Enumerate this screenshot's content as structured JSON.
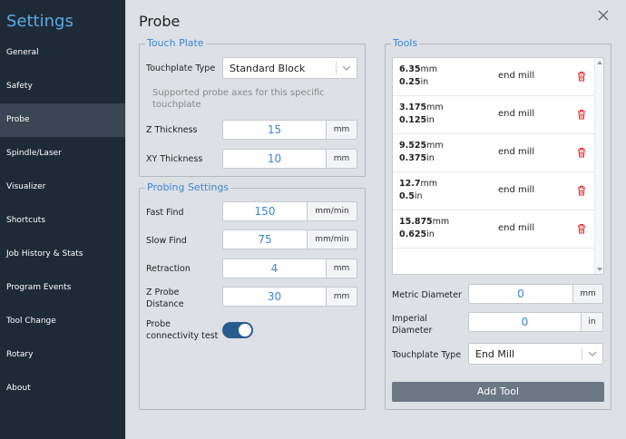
{
  "sidebar": {
    "title": "Settings",
    "items": [
      {
        "label": "General"
      },
      {
        "label": "Safety"
      },
      {
        "label": "Probe"
      },
      {
        "label": "Spindle/Laser"
      },
      {
        "label": "Visualizer"
      },
      {
        "label": "Shortcuts"
      },
      {
        "label": "Job History & Stats"
      },
      {
        "label": "Program Events"
      },
      {
        "label": "Tool Change"
      },
      {
        "label": "Rotary"
      },
      {
        "label": "About"
      }
    ],
    "active": "Probe"
  },
  "page": {
    "title": "Probe"
  },
  "touch_plate": {
    "legend": "Touch Plate",
    "type_label": "Touchplate Type",
    "type_value": "Standard Block",
    "hint": "Supported probe axes for this specific touchplate",
    "z_thickness": {
      "label": "Z Thickness",
      "value": "15",
      "unit": "mm"
    },
    "xy_thickness": {
      "label": "XY Thickness",
      "value": "10",
      "unit": "mm"
    }
  },
  "probing": {
    "legend": "Probing Settings",
    "fast_find": {
      "label": "Fast Find",
      "value": "150",
      "unit": "mm/min"
    },
    "slow_find": {
      "label": "Slow Find",
      "value": "75",
      "unit": "mm/min"
    },
    "retraction": {
      "label": "Retraction",
      "value": "4",
      "unit": "mm"
    },
    "z_probe_distance": {
      "label_line1": "Z Probe",
      "label_line2": "Distance",
      "value": "30",
      "unit": "mm"
    },
    "connectivity": {
      "label_line1": "Probe",
      "label_line2": "connectivity test",
      "enabled": true
    }
  },
  "tools": {
    "legend": "Tools",
    "list": [
      {
        "metric": "6.35",
        "metric_unit": "mm",
        "imperial": "0.25",
        "imperial_unit": "in",
        "type": "end mill"
      },
      {
        "metric": "3.175",
        "metric_unit": "mm",
        "imperial": "0.125",
        "imperial_unit": "in",
        "type": "end mill"
      },
      {
        "metric": "9.525",
        "metric_unit": "mm",
        "imperial": "0.375",
        "imperial_unit": "in",
        "type": "end mill"
      },
      {
        "metric": "12.7",
        "metric_unit": "mm",
        "imperial": "0.5",
        "imperial_unit": "in",
        "type": "end mill"
      },
      {
        "metric": "15.875",
        "metric_unit": "mm",
        "imperial": "0.625",
        "imperial_unit": "in",
        "type": "end mill"
      }
    ],
    "metric_diameter": {
      "label": "Metric Diameter",
      "value": "0",
      "unit": "mm"
    },
    "imperial_diameter": {
      "label_line1": "Imperial",
      "label_line2": "Diameter",
      "value": "0",
      "unit": "in"
    },
    "touchplate_type": {
      "label": "Touchplate Type",
      "value": "End Mill"
    },
    "add_button": "Add Tool"
  },
  "colors": {
    "accent": "#3a87d4",
    "sidebar_bg": "#1f2a37",
    "delete": "#e02424",
    "toggle": "#295d8e"
  }
}
